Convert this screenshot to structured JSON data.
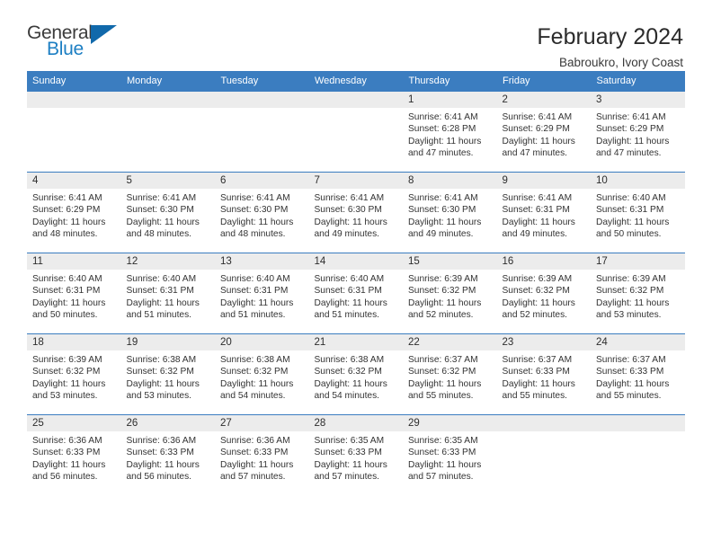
{
  "brand": {
    "name_part1": "General",
    "name_part2": "Blue",
    "logo_icon": "blue-triangle-icon",
    "accent_color": "#1169ab"
  },
  "header": {
    "title": "February 2024",
    "location": "Babroukro, Ivory Coast"
  },
  "calendar": {
    "header_bg": "#3b7dc0",
    "daynum_bg": "#ececec",
    "weekdays": [
      "Sunday",
      "Monday",
      "Tuesday",
      "Wednesday",
      "Thursday",
      "Friday",
      "Saturday"
    ],
    "weeks": [
      [
        {
          "day": "",
          "lines": []
        },
        {
          "day": "",
          "lines": []
        },
        {
          "day": "",
          "lines": []
        },
        {
          "day": "",
          "lines": []
        },
        {
          "day": "1",
          "lines": [
            "Sunrise: 6:41 AM",
            "Sunset: 6:28 PM",
            "Daylight: 11 hours",
            "and 47 minutes."
          ]
        },
        {
          "day": "2",
          "lines": [
            "Sunrise: 6:41 AM",
            "Sunset: 6:29 PM",
            "Daylight: 11 hours",
            "and 47 minutes."
          ]
        },
        {
          "day": "3",
          "lines": [
            "Sunrise: 6:41 AM",
            "Sunset: 6:29 PM",
            "Daylight: 11 hours",
            "and 47 minutes."
          ]
        }
      ],
      [
        {
          "day": "4",
          "lines": [
            "Sunrise: 6:41 AM",
            "Sunset: 6:29 PM",
            "Daylight: 11 hours",
            "and 48 minutes."
          ]
        },
        {
          "day": "5",
          "lines": [
            "Sunrise: 6:41 AM",
            "Sunset: 6:30 PM",
            "Daylight: 11 hours",
            "and 48 minutes."
          ]
        },
        {
          "day": "6",
          "lines": [
            "Sunrise: 6:41 AM",
            "Sunset: 6:30 PM",
            "Daylight: 11 hours",
            "and 48 minutes."
          ]
        },
        {
          "day": "7",
          "lines": [
            "Sunrise: 6:41 AM",
            "Sunset: 6:30 PM",
            "Daylight: 11 hours",
            "and 49 minutes."
          ]
        },
        {
          "day": "8",
          "lines": [
            "Sunrise: 6:41 AM",
            "Sunset: 6:30 PM",
            "Daylight: 11 hours",
            "and 49 minutes."
          ]
        },
        {
          "day": "9",
          "lines": [
            "Sunrise: 6:41 AM",
            "Sunset: 6:31 PM",
            "Daylight: 11 hours",
            "and 49 minutes."
          ]
        },
        {
          "day": "10",
          "lines": [
            "Sunrise: 6:40 AM",
            "Sunset: 6:31 PM",
            "Daylight: 11 hours",
            "and 50 minutes."
          ]
        }
      ],
      [
        {
          "day": "11",
          "lines": [
            "Sunrise: 6:40 AM",
            "Sunset: 6:31 PM",
            "Daylight: 11 hours",
            "and 50 minutes."
          ]
        },
        {
          "day": "12",
          "lines": [
            "Sunrise: 6:40 AM",
            "Sunset: 6:31 PM",
            "Daylight: 11 hours",
            "and 51 minutes."
          ]
        },
        {
          "day": "13",
          "lines": [
            "Sunrise: 6:40 AM",
            "Sunset: 6:31 PM",
            "Daylight: 11 hours",
            "and 51 minutes."
          ]
        },
        {
          "day": "14",
          "lines": [
            "Sunrise: 6:40 AM",
            "Sunset: 6:31 PM",
            "Daylight: 11 hours",
            "and 51 minutes."
          ]
        },
        {
          "day": "15",
          "lines": [
            "Sunrise: 6:39 AM",
            "Sunset: 6:32 PM",
            "Daylight: 11 hours",
            "and 52 minutes."
          ]
        },
        {
          "day": "16",
          "lines": [
            "Sunrise: 6:39 AM",
            "Sunset: 6:32 PM",
            "Daylight: 11 hours",
            "and 52 minutes."
          ]
        },
        {
          "day": "17",
          "lines": [
            "Sunrise: 6:39 AM",
            "Sunset: 6:32 PM",
            "Daylight: 11 hours",
            "and 53 minutes."
          ]
        }
      ],
      [
        {
          "day": "18",
          "lines": [
            "Sunrise: 6:39 AM",
            "Sunset: 6:32 PM",
            "Daylight: 11 hours",
            "and 53 minutes."
          ]
        },
        {
          "day": "19",
          "lines": [
            "Sunrise: 6:38 AM",
            "Sunset: 6:32 PM",
            "Daylight: 11 hours",
            "and 53 minutes."
          ]
        },
        {
          "day": "20",
          "lines": [
            "Sunrise: 6:38 AM",
            "Sunset: 6:32 PM",
            "Daylight: 11 hours",
            "and 54 minutes."
          ]
        },
        {
          "day": "21",
          "lines": [
            "Sunrise: 6:38 AM",
            "Sunset: 6:32 PM",
            "Daylight: 11 hours",
            "and 54 minutes."
          ]
        },
        {
          "day": "22",
          "lines": [
            "Sunrise: 6:37 AM",
            "Sunset: 6:32 PM",
            "Daylight: 11 hours",
            "and 55 minutes."
          ]
        },
        {
          "day": "23",
          "lines": [
            "Sunrise: 6:37 AM",
            "Sunset: 6:33 PM",
            "Daylight: 11 hours",
            "and 55 minutes."
          ]
        },
        {
          "day": "24",
          "lines": [
            "Sunrise: 6:37 AM",
            "Sunset: 6:33 PM",
            "Daylight: 11 hours",
            "and 55 minutes."
          ]
        }
      ],
      [
        {
          "day": "25",
          "lines": [
            "Sunrise: 6:36 AM",
            "Sunset: 6:33 PM",
            "Daylight: 11 hours",
            "and 56 minutes."
          ]
        },
        {
          "day": "26",
          "lines": [
            "Sunrise: 6:36 AM",
            "Sunset: 6:33 PM",
            "Daylight: 11 hours",
            "and 56 minutes."
          ]
        },
        {
          "day": "27",
          "lines": [
            "Sunrise: 6:36 AM",
            "Sunset: 6:33 PM",
            "Daylight: 11 hours",
            "and 57 minutes."
          ]
        },
        {
          "day": "28",
          "lines": [
            "Sunrise: 6:35 AM",
            "Sunset: 6:33 PM",
            "Daylight: 11 hours",
            "and 57 minutes."
          ]
        },
        {
          "day": "29",
          "lines": [
            "Sunrise: 6:35 AM",
            "Sunset: 6:33 PM",
            "Daylight: 11 hours",
            "and 57 minutes."
          ]
        },
        {
          "day": "",
          "lines": []
        },
        {
          "day": "",
          "lines": []
        }
      ]
    ]
  }
}
